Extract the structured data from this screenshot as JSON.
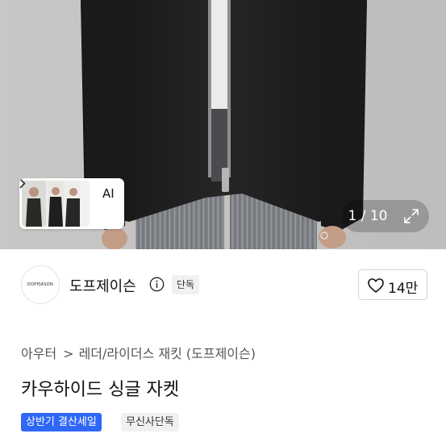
{
  "gallery": {
    "ai_label": "AI",
    "current": "1",
    "total": "10",
    "counter_text": "1 / 10",
    "icons": {
      "thumb_chevron": "chevron-right-icon",
      "expand": "expand-icon"
    }
  },
  "brand": {
    "logo_text": "DOPPJASON",
    "name": "도프제이슨",
    "badge": "단독",
    "info_icon": "info-icon"
  },
  "like": {
    "icon": "heart-icon",
    "count": "14만"
  },
  "breadcrumb": {
    "items": [
      "아우터",
      "레더/라이더스 재킷 (도프제이슨)"
    ],
    "separator": ">"
  },
  "product": {
    "title": "카우하이드 싱글 자켓",
    "tags": [
      "상반기 결산세일",
      "무신사단독"
    ]
  },
  "colors": {
    "accent_blue": "#2f67f6",
    "tag_gray": "#f1f1f1",
    "jacket": "#1c1c1c"
  }
}
